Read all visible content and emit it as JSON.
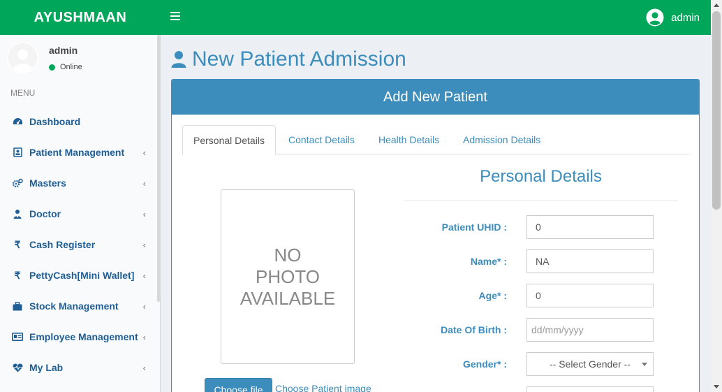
{
  "header": {
    "logo": "AYUSHMAAN",
    "user_name": "admin"
  },
  "sidebar": {
    "user_name": "admin",
    "status": "Online",
    "menu_header": "MENU",
    "items": [
      {
        "label": "Dashboard",
        "icon": "dashboard-icon",
        "chevron": ""
      },
      {
        "label": "Patient Management",
        "icon": "patient-card-icon",
        "chevron": "‹"
      },
      {
        "label": "Masters",
        "icon": "cogs-icon",
        "chevron": "‹"
      },
      {
        "label": "Doctor",
        "icon": "user-md-icon",
        "chevron": "‹"
      },
      {
        "label": "Cash Register",
        "icon": "rupee-icon",
        "chevron": "‹"
      },
      {
        "label": "PettyCash[Mini Wallet]",
        "icon": "rupee-icon",
        "chevron": "‹"
      },
      {
        "label": "Stock Management",
        "icon": "briefcase-icon",
        "chevron": "‹"
      },
      {
        "label": "Employee Management",
        "icon": "id-card-icon",
        "chevron": "‹"
      },
      {
        "label": "My Lab",
        "icon": "heartbeat-icon",
        "chevron": "‹"
      }
    ]
  },
  "page": {
    "title": "New Patient Admission"
  },
  "box": {
    "header": "Add New Patient",
    "tabs": [
      "Personal Details",
      "Contact Details",
      "Health Details",
      "Admission Details"
    ],
    "photo_lines": [
      "NO",
      "PHOTO",
      "AVAILABLE"
    ],
    "file_button": "Choose file",
    "file_text": "Choose Patient image",
    "section_title": "Personal Details",
    "fields": [
      {
        "label": "Patient UHID :",
        "value": "0"
      },
      {
        "label": "Name* :",
        "value": "NA"
      },
      {
        "label": "Age* :",
        "value": "0"
      },
      {
        "label": "Date Of Birth :",
        "placeholder": "dd/mm/yyyy"
      },
      {
        "label": "Gender* :",
        "selected": "-- Select Gender --"
      }
    ]
  },
  "colors": {
    "header_green": "#00a65a",
    "primary_blue": "#3c8dbc",
    "menu_text": "#1f5f95",
    "content_bg": "#ecf0f5"
  }
}
